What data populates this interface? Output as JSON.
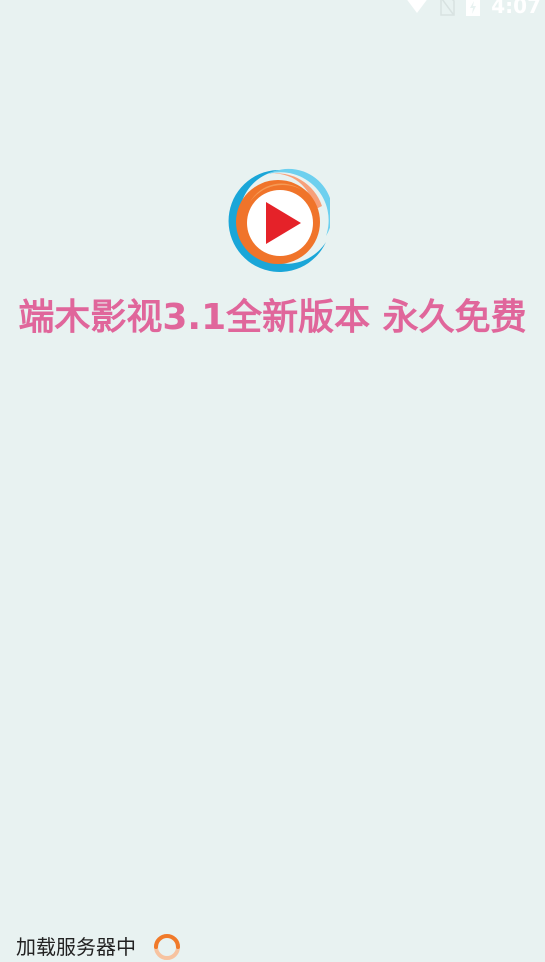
{
  "status_bar": {
    "time": "4:07",
    "icons": [
      "wifi-icon",
      "sim-icon",
      "battery-icon"
    ]
  },
  "splash": {
    "logo_icon": "play-logo-icon",
    "headline": "端木影视3.1全新版本 永久免费",
    "headline_color": "#e0669b"
  },
  "loading": {
    "text": "加载服务器中",
    "spinner_icon": "loading-spinner-icon",
    "spinner_color": "#f07a2a"
  },
  "colors": {
    "background": "#e8f2f1",
    "logo_blue": "#1aa6d8",
    "logo_orange": "#f0742a",
    "logo_red": "#e52229"
  }
}
